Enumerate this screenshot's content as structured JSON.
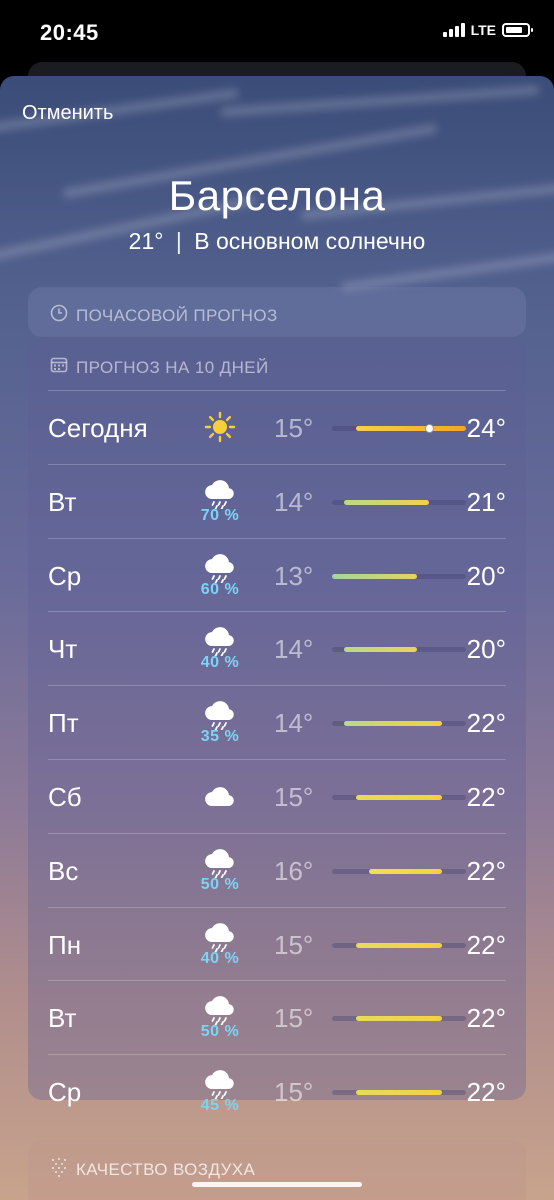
{
  "status_bar": {
    "time": "20:45",
    "network": "LTE"
  },
  "header": {
    "cancel_label": "Отменить",
    "city": "Барселона",
    "current_temp": "21°",
    "separator": "|",
    "condition": "В основном солнечно"
  },
  "hourly": {
    "title": "ПОЧАСОВОЙ ПРОГНОЗ",
    "icon": "clock-icon"
  },
  "forecast": {
    "title": "ПРОГНОЗ НА 10 ДНЕЙ",
    "icon": "calendar-icon",
    "range": [
      13,
      24
    ],
    "days": [
      {
        "day": "Сегодня",
        "icon": "sun",
        "precip": "",
        "low": "15°",
        "high": "24°",
        "low_val": 15,
        "high_val": 24,
        "current": 21,
        "colors": [
          "#f0d44a",
          "#f5a623"
        ]
      },
      {
        "day": "Вт",
        "icon": "rain",
        "precip": "70 %",
        "low": "14°",
        "high": "21°",
        "low_val": 14,
        "high_val": 21,
        "colors": [
          "#b9d98a",
          "#f0d24a"
        ]
      },
      {
        "day": "Ср",
        "icon": "rain",
        "precip": "60 %",
        "low": "13°",
        "high": "20°",
        "low_val": 13,
        "high_val": 20,
        "colors": [
          "#9fd6a4",
          "#e6d45a"
        ]
      },
      {
        "day": "Чт",
        "icon": "rain",
        "precip": "40 %",
        "low": "14°",
        "high": "20°",
        "low_val": 14,
        "high_val": 20,
        "colors": [
          "#b9d98a",
          "#e6d45a"
        ]
      },
      {
        "day": "Пт",
        "icon": "rain",
        "precip": "35 %",
        "low": "14°",
        "high": "22°",
        "low_val": 14,
        "high_val": 22,
        "colors": [
          "#b9d98a",
          "#f5d040"
        ]
      },
      {
        "day": "Сб",
        "icon": "cloud",
        "precip": "",
        "low": "15°",
        "high": "22°",
        "low_val": 15,
        "high_val": 22,
        "colors": [
          "#e6dc5a",
          "#f5d040"
        ]
      },
      {
        "day": "Вс",
        "icon": "rain",
        "precip": "50 %",
        "low": "16°",
        "high": "22°",
        "low_val": 16,
        "high_val": 22,
        "colors": [
          "#ede05a",
          "#f5d040"
        ]
      },
      {
        "day": "Пн",
        "icon": "rain",
        "precip": "40 %",
        "low": "15°",
        "high": "22°",
        "low_val": 15,
        "high_val": 22,
        "colors": [
          "#e6dc5a",
          "#f5d040"
        ]
      },
      {
        "day": "Вт",
        "icon": "rain",
        "precip": "50 %",
        "low": "15°",
        "high": "22°",
        "low_val": 15,
        "high_val": 22,
        "colors": [
          "#e6dc5a",
          "#f5d040"
        ]
      },
      {
        "day": "Ср",
        "icon": "rain",
        "precip": "45 %",
        "low": "15°",
        "high": "22°",
        "low_val": 15,
        "high_val": 22,
        "colors": [
          "#e6dc5a",
          "#f5d040"
        ]
      }
    ]
  },
  "air_quality": {
    "title": "КАЧЕСТВО ВОЗДУХА",
    "icon": "air-quality-icon"
  }
}
